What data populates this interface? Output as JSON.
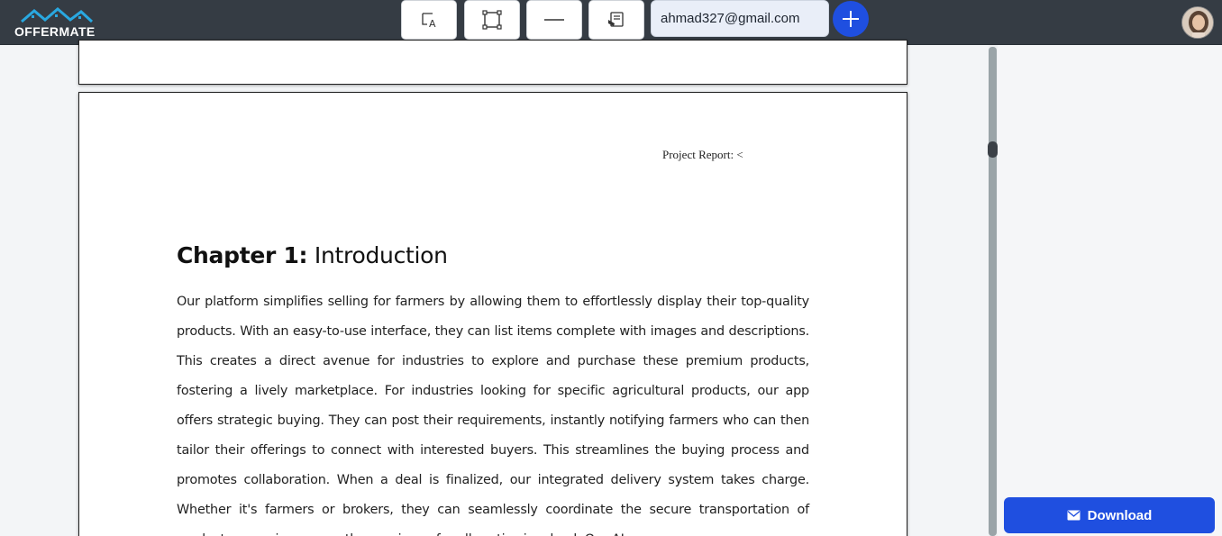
{
  "app": {
    "brand": "OFFERMATE",
    "accent_color": "#1f4fe0",
    "topbar_color": "#353c44"
  },
  "toolbar": {
    "tools": [
      {
        "name": "text-tool",
        "icon": "text-box-icon"
      },
      {
        "name": "rectangle-tool",
        "icon": "square-selection-icon"
      },
      {
        "name": "line-tool",
        "icon": "horizontal-line-icon"
      },
      {
        "name": "signature-tool",
        "icon": "signature-pad-icon"
      }
    ],
    "signer_email": "ahmad327@gmail.com",
    "add_icon": "plus-icon"
  },
  "document": {
    "header_text": "Project Report: <",
    "chapter_label": "Chapter 1:",
    "chapter_title": "Introduction",
    "body": "Our platform simplifies selling for farmers by allowing them to effortlessly display their top-quality products. With an easy-to-use interface, they can list items complete with images and descriptions. This creates a direct avenue for industries to explore and purchase these premium products, fostering a lively marketplace. For industries looking for specific agricultural products, our app offers strategic buying. They can post their requirements, instantly notifying farmers who can then tailor their offerings to connect with interested buyers. This streamlines the buying process and promotes collaboration. When a deal is finalized, our integrated delivery system takes charge. Whether it's farmers or brokers, they can seamlessly coordinate the secure transportation of products, ensuring a smooth experience for all parties involved. Our AI"
  },
  "actions": {
    "download_label": "Download",
    "download_icon": "envelope-icon"
  }
}
